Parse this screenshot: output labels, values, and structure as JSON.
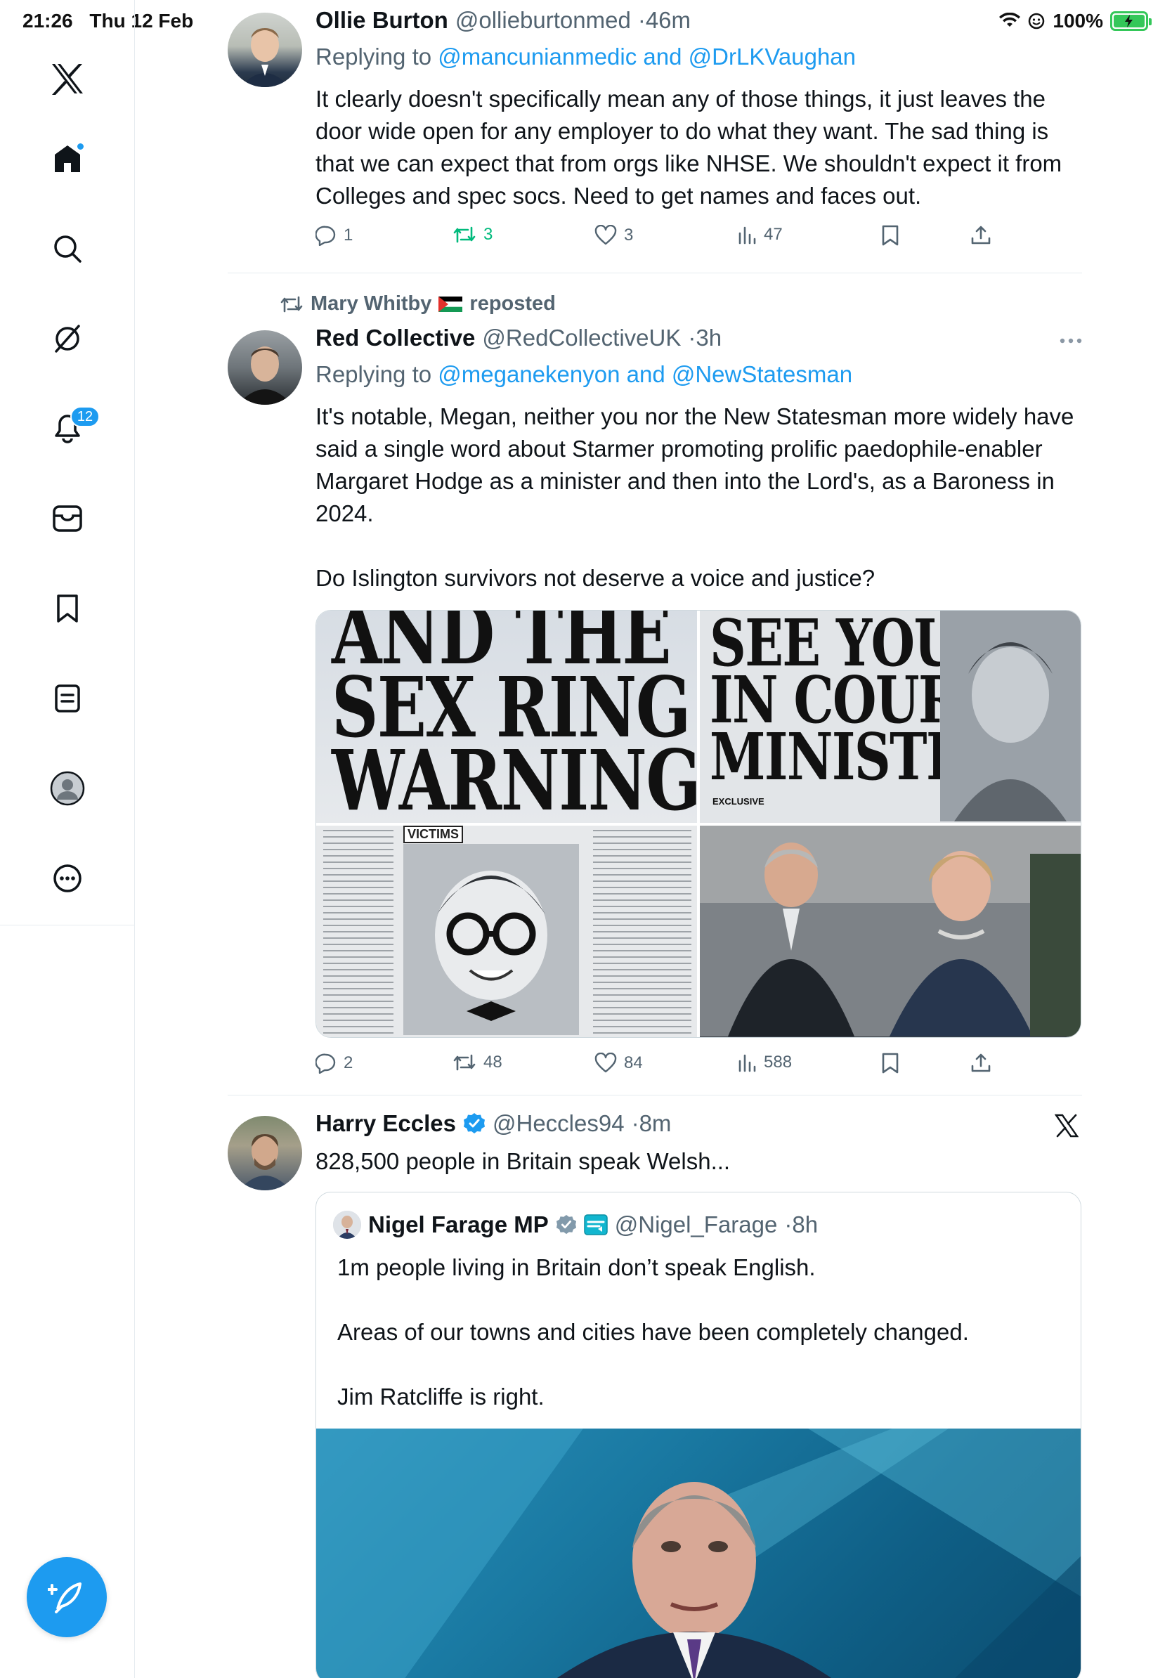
{
  "status_bar": {
    "time": "21:26",
    "date": "Thu 12 Feb",
    "battery": "100%"
  },
  "sidebar": {
    "notifications_badge": "12"
  },
  "tweets": [
    {
      "display_name": "Ollie Burton",
      "handle": "@ollieburtonmed",
      "time": "46m",
      "replying_prefix": "Replying to",
      "replying_targets": "@mancunianmedic and @DrLKVaughan",
      "text": "It clearly doesn't specifically mean any of those things, it just leaves the door wide open for any employer to do what they want. The sad thing is that we can expect that from orgs like NHSE. We shouldn't expect it from Colleges and spec socs. Need to get names and faces out.",
      "replies": "1",
      "reposts": "3",
      "likes": "3",
      "views": "47"
    },
    {
      "reposted_by": "Mary Whitby",
      "reposted_label": "reposted",
      "display_name": "Red Collective",
      "handle": "@RedCollectiveUK",
      "time": "3h",
      "replying_prefix": "Replying to",
      "replying_targets": "@meganekenyon and @NewStatesman",
      "text": "It's notable, Megan, neither you nor the New Statesman more widely have said a single word about Starmer promoting prolific paedophile-enabler Margaret Hodge as a minister and then into the Lord's, as a Baroness in 2024.\n\nDo Islington survivors not deserve a voice and justice?",
      "media": {
        "headline_1": "AND THE\nSEX RING\nWARNING",
        "headline_2": "SEE YOU\nIN COURT\nMINISTER",
        "caption_victims": "VICTIMS",
        "caption_exclusive": "EXCLUSIVE"
      },
      "replies": "2",
      "reposts": "48",
      "likes": "84",
      "views": "588"
    },
    {
      "display_name": "Harry Eccles",
      "handle": "@Heccles94",
      "time": "8m",
      "text": "828,500 people in Britain speak Welsh...",
      "quote": {
        "display_name": "Nigel Farage MP",
        "handle": "@Nigel_Farage",
        "time": "8h",
        "text": "1m people living in Britain don’t speak English.\n\nAreas of our towns and cities have been completely changed.\n\nJim Ratcliffe is right."
      }
    }
  ],
  "colors": {
    "accent": "#1d9bf0",
    "repost_green": "#00ba7c",
    "muted": "#536471"
  }
}
